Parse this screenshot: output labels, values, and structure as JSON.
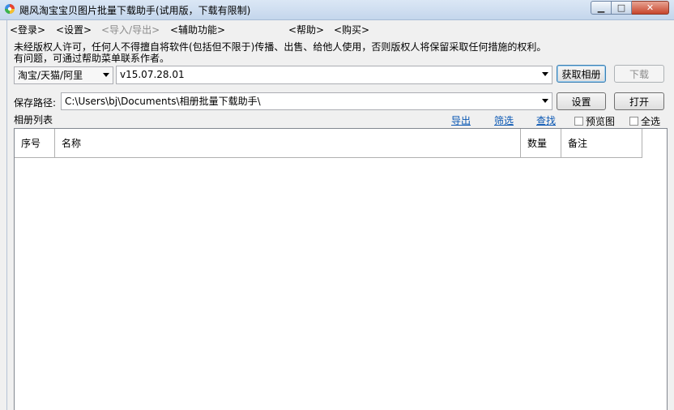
{
  "window": {
    "title": "飓风淘宝宝贝图片批量下载助手(试用版，下载有限制)",
    "min_glyph": "▁",
    "max_glyph": "□",
    "close_glyph": "✕"
  },
  "menu": [
    {
      "label": "<登录>"
    },
    {
      "label": "<设置>"
    },
    {
      "label": "<导入/导出>"
    },
    {
      "label": "<辅助功能>"
    },
    {
      "label": "<帮助>"
    },
    {
      "label": "<购买>"
    }
  ],
  "notice": {
    "line1": "未经版权人许可，任何人不得擅自将软件(包括但不限于)传播、出售、给他人使用，否则版权人将保留采取任何措施的权利。",
    "line2": "有问题，可通过帮助菜单联系作者。"
  },
  "source_select": {
    "value": "淘宝/天猫/阿里"
  },
  "url_input": {
    "value": "v15.07.28.01"
  },
  "buttons": {
    "fetch": "获取相册",
    "download": "下载",
    "settings": "设置",
    "open": "打开"
  },
  "save_path": {
    "label": "保存路径:",
    "value": "C:\\Users\\bj\\Documents\\相册批量下载助手\\"
  },
  "album_list": {
    "label": "相册列表",
    "export_link": "导出",
    "filter_link": "筛选",
    "find_link": "查找",
    "preview_label": "预览图",
    "select_all_label": "全选",
    "columns": [
      "序号",
      "名称",
      "数量",
      "备注"
    ]
  }
}
